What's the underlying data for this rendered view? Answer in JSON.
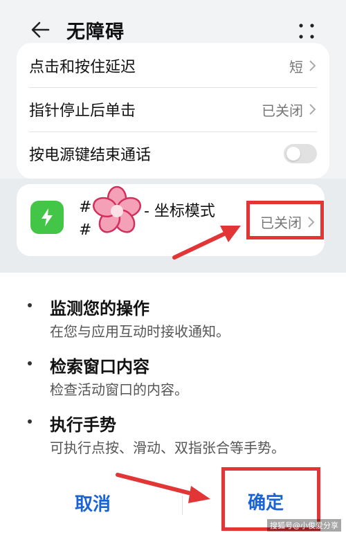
{
  "header": {
    "title": "无障碍"
  },
  "settings": [
    {
      "label": "点击和按住延迟",
      "value": "短"
    },
    {
      "label": "指针停止后单击",
      "value": "已关闭"
    },
    {
      "label": "按电源键结束通话",
      "toggle": false
    }
  ],
  "service": {
    "name_line1": "#",
    "name_suffix": "- 坐标模式",
    "name_line2": "#",
    "status": "已关闭"
  },
  "permissions": [
    {
      "title": "监测您的操作",
      "desc": "在您与应用互动时接收通知。"
    },
    {
      "title": "检索窗口内容",
      "desc": "检查活动窗口的内容。"
    },
    {
      "title": "执行手势",
      "desc": "可执行点按、滑动、双指张合等手势。"
    }
  ],
  "dialog": {
    "cancel": "取消",
    "confirm": "确定"
  },
  "watermark": "搜狐号@小俊爱分享",
  "colors": {
    "accent": "#1a62d8",
    "highlight": "#e23535",
    "app_icon": "#43c548"
  },
  "icons": [
    "back-arrow-icon",
    "more-options-icon",
    "chevron-right-icon",
    "lightning-icon",
    "flower-sticker-icon"
  ]
}
